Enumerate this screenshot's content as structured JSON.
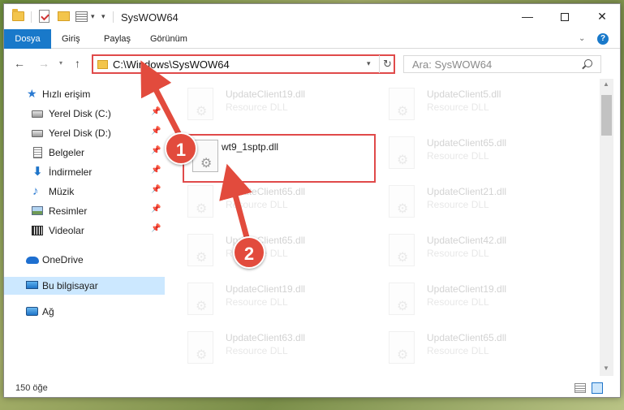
{
  "window": {
    "title": "SysWOW64"
  },
  "ribbon": {
    "tabs": [
      {
        "label": "Dosya"
      },
      {
        "label": "Giriş"
      },
      {
        "label": "Paylaş"
      },
      {
        "label": "Görünüm"
      }
    ]
  },
  "nav": {
    "address": "C:\\Windows\\SysWOW64",
    "search_placeholder": "Ara: SysWOW64"
  },
  "sidebar": {
    "items": [
      {
        "label": "Hızlı erişim",
        "icon": "star-icon"
      },
      {
        "label": "Yerel Disk (C:)",
        "icon": "drive-icon",
        "pinned": true
      },
      {
        "label": "Yerel Disk (D:)",
        "icon": "drive-icon",
        "pinned": true
      },
      {
        "label": "Belgeler",
        "icon": "documents-icon",
        "pinned": true
      },
      {
        "label": "İndirmeler",
        "icon": "downloads-icon",
        "pinned": true
      },
      {
        "label": "Müzik",
        "icon": "music-icon",
        "pinned": true
      },
      {
        "label": "Resimler",
        "icon": "pictures-icon",
        "pinned": true
      },
      {
        "label": "Videolar",
        "icon": "videos-icon",
        "pinned": true
      },
      {
        "label": "OneDrive",
        "icon": "onedrive-icon"
      },
      {
        "label": "Bu bilgisayar",
        "icon": "this-pc-icon",
        "selected": true
      },
      {
        "label": "Ağ",
        "icon": "network-icon"
      }
    ]
  },
  "files": {
    "left": [
      {
        "name": "UpdateClient19.dll",
        "type": "Resource DLL"
      },
      {
        "name": "wt9_1sptp.dll",
        "type": ""
      },
      {
        "name": "UpdateClient65.dll",
        "type": "Resource DLL"
      },
      {
        "name": "UpdateClient65.dll",
        "type": "Resource DLL"
      },
      {
        "name": "UpdateClient19.dll",
        "type": "Resource DLL"
      },
      {
        "name": "UpdateClient63.dll",
        "type": "Resource DLL"
      }
    ],
    "right": [
      {
        "name": "UpdateClient5.dll",
        "type": "Resource DLL"
      },
      {
        "name": "UpdateClient65.dll",
        "type": "Resource DLL"
      },
      {
        "name": "UpdateClient21.dll",
        "type": "Resource DLL"
      },
      {
        "name": "UpdateClient42.dll",
        "type": "Resource DLL"
      },
      {
        "name": "UpdateClient19.dll",
        "type": "Resource DLL"
      },
      {
        "name": "UpdateClient65.dll",
        "type": "Resource DLL"
      }
    ]
  },
  "status": {
    "item_count": "150 öğe"
  },
  "annotations": {
    "step1": "1",
    "step2": "2"
  },
  "colors": {
    "accent": "#1979ca",
    "highlight": "#e04a4a",
    "badge": "#e24b3d"
  }
}
